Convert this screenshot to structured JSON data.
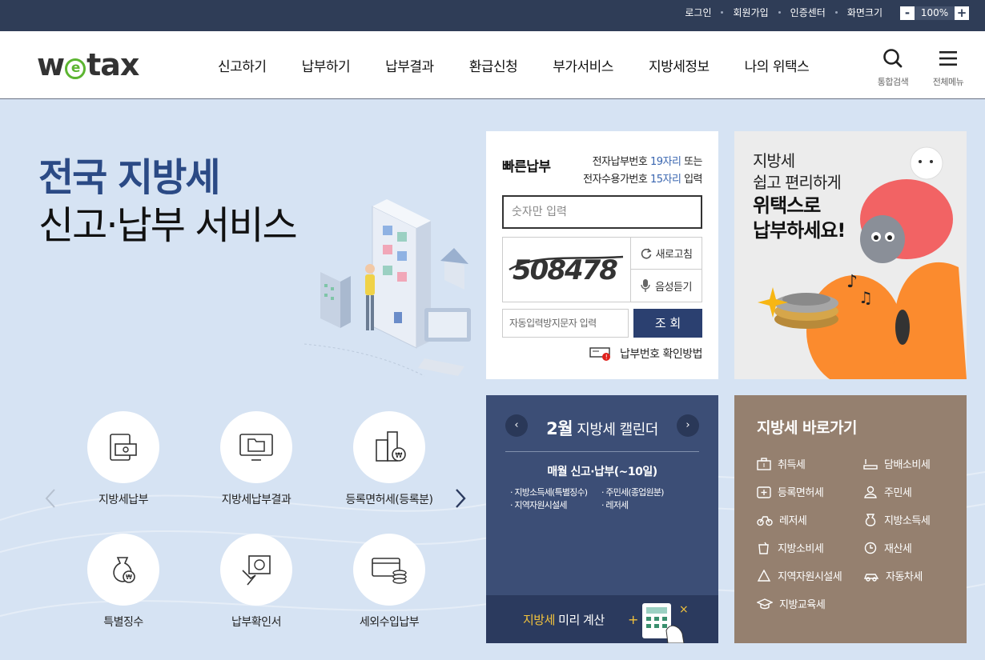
{
  "topbar": {
    "links": [
      "로그인",
      "회원가입",
      "인증센터",
      "화면크기"
    ],
    "zoom_minus": "-",
    "zoom_value": "100%",
    "zoom_plus": "+"
  },
  "header": {
    "logo_prefix": "w",
    "logo_e": "e",
    "logo_suffix": "tax",
    "nav": [
      "신고하기",
      "납부하기",
      "납부결과",
      "환급신청",
      "부가서비스",
      "지방세정보",
      "나의 위택스"
    ],
    "search_label": "통합검색",
    "menu_label": "전체메뉴"
  },
  "hero": {
    "line1": "전국 지방세",
    "line2": "신고·납부 서비스"
  },
  "quick_pay": {
    "title": "빠른납부",
    "desc1_pre": "전자납부번호 ",
    "desc1_em": "19자리",
    "desc1_post": " 또는",
    "desc2_pre": "전자수용가번호 ",
    "desc2_em": "15자리",
    "desc2_post": " 입력",
    "input_placeholder": "숫자만 입력",
    "captcha_code": "508478",
    "refresh_label": "새로고침",
    "audio_label": "음성듣기",
    "captcha_placeholder": "자동입력방지문자 입력",
    "submit_label": "조 회",
    "help_label": "납부번호 확인방법"
  },
  "banner": {
    "line1": "지방세",
    "line2": "쉽고 편리하게",
    "line3": "위택스로",
    "line4": "납부하세요!"
  },
  "calendar": {
    "prev": "‹",
    "next": "›",
    "month": "2월",
    "title_rest": " 지방세 캘린더",
    "subtitle": "매월 신고·납부(~10일)",
    "items": [
      "지방소득세(특별징수)",
      "주민세(종업원분)",
      "지역자원시설세",
      "레저세"
    ],
    "calc_em": "지방세",
    "calc_rest": " 미리 계산"
  },
  "shortcuts": {
    "title": "지방세 바로가기",
    "items": [
      "취득세",
      "담배소비세",
      "등록면허세",
      "주민세",
      "레저세",
      "지방소득세",
      "지방소비세",
      "재산세",
      "지역자원시설세",
      "자동차세",
      "지방교육세"
    ]
  },
  "services": {
    "items": [
      "지방세납부",
      "지방세납부결과",
      "등록면허세(등록분)",
      "특별징수",
      "납부확인서",
      "세외수입납부"
    ],
    "prev": "‹",
    "next": "›"
  }
}
